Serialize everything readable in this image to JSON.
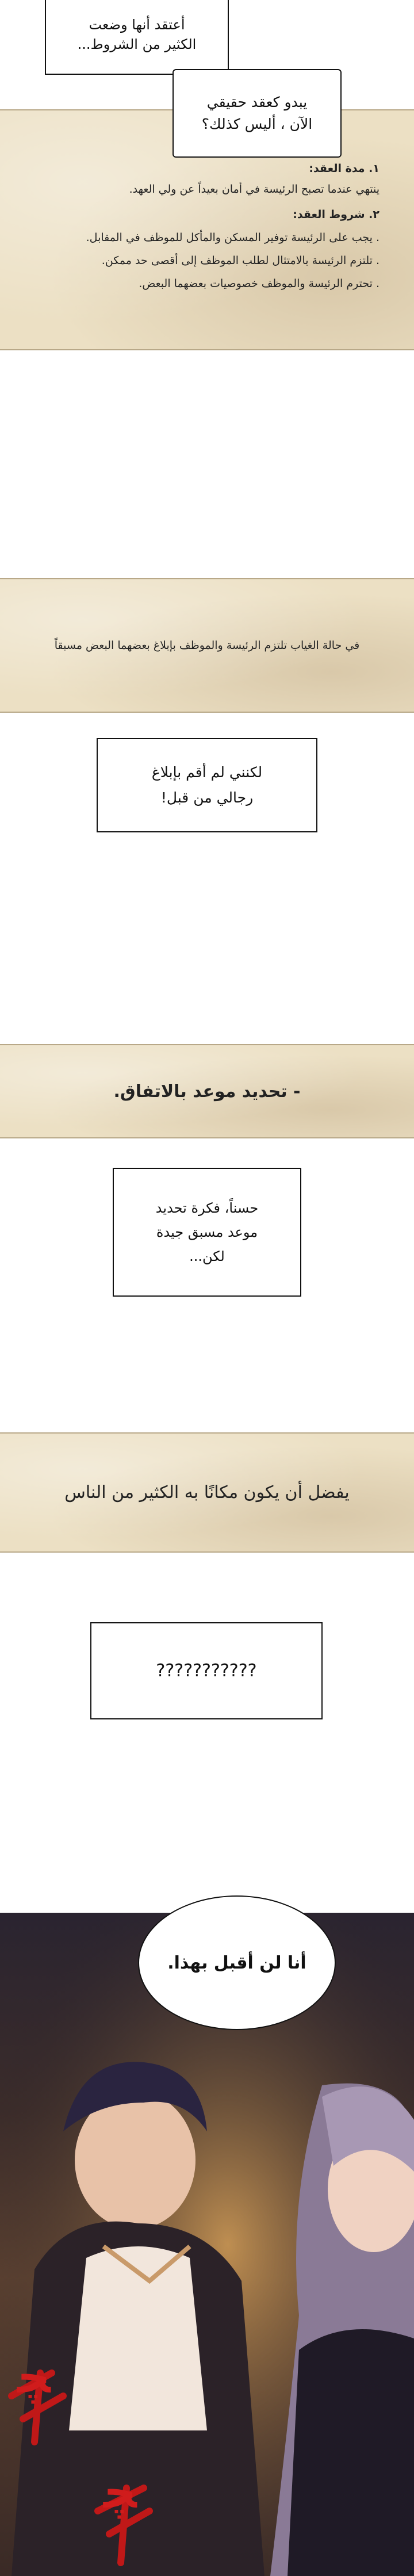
{
  "top_box": {
    "line1": "أعتقد أنها وضعت",
    "line2": "الكثير من الشروط..."
  },
  "top_bubble": {
    "line1": "يبدو كعقد حقيقي",
    "line2": "الآن ، أليس كذلك؟"
  },
  "contract": {
    "h1": "١. مدة العقد:",
    "p1": "ينتهي عندما تصبح الرئيسة في أمان بعيداً عن ولي العهد.",
    "h2": "٢. شروط العقد:",
    "items": [
      ". يجب على الرئيسة توفير المسكن والمأكل للموظف في المقابل.",
      ". تلتزم الرئيسة بالامتثال لطلب الموظف إلى أقصى حد ممكن.",
      ". تحترم الرئيسة والموظف خصوصيات بعضهما البعض."
    ]
  },
  "strip1": "في حالة الغياب تلتزم الرئيسة والموظف بإبلاغ بعضهما البعض مسبقاً",
  "box2": {
    "line1": "لكنني لم أقم بإبلاغ",
    "line2": "رجالي من قبل!"
  },
  "strip2": "- تحديد موعد بالاتفاق.",
  "box3": {
    "line1": "حسناً، فكرة تحديد",
    "line2": "موعد مسبق جيدة",
    "line3": "لكن..."
  },
  "strip3": "يفضل أن يكون مكانًا به الكثير من الناس",
  "box4": "???????????",
  "final_bubble": "أنا لن أقبل بهذا.",
  "sfx": [
    "ﭽ",
    "ﭽ"
  ]
}
